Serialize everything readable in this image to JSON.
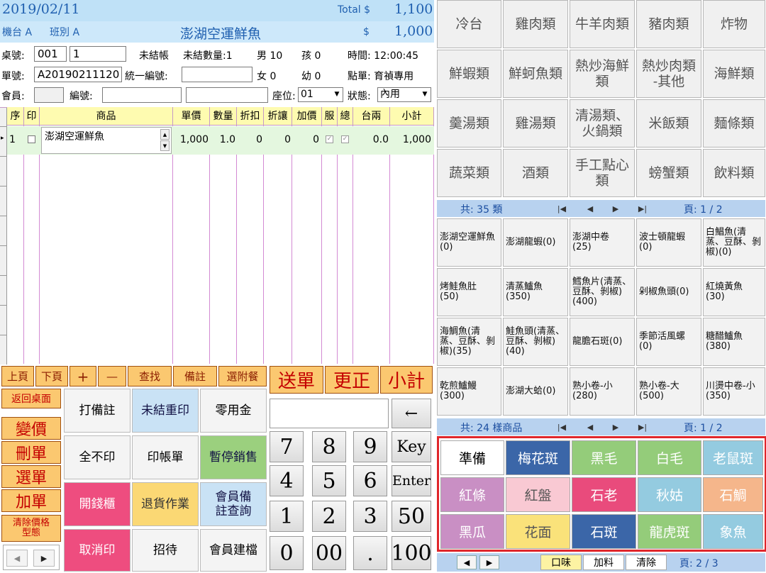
{
  "header": {
    "date": "2019/02/11",
    "total_label": "Total $",
    "total_value": "1,100",
    "register": "機台 A",
    "shift": "班別 A",
    "item_name": "澎湖空運鮮魚",
    "item_dollar": "$",
    "item_price": "1,000"
  },
  "info": {
    "table_label": "桌號:",
    "table_no": "001",
    "table_sub": "1",
    "unsettled": "未結帳",
    "unsettled_qty": "未結數量:1",
    "male": "男 10",
    "child": "孩 0",
    "time": "時間: 12:00:45",
    "order_label": "單號:",
    "order_no": "A20190211120",
    "tax_label": "統一編號:",
    "female": "女 0",
    "infant": "幼 0",
    "ordered_by": "點單: 育禎專用",
    "member_label": "會員:",
    "member_no_label": "編號:",
    "seat_label": "座位:",
    "seat_value": "01",
    "status_label": "狀態:",
    "status_value": "內用"
  },
  "table": {
    "headers": [
      "序",
      "印",
      "商品",
      "單價",
      "數量",
      "折扣",
      "折讓",
      "加價",
      "服",
      "總",
      "台兩",
      "小計"
    ],
    "rows": [
      {
        "seq": "1",
        "name": "澎湖空運鮮魚",
        "price": "1,000",
        "qty": "1.0",
        "disc": "0",
        "allow": "0",
        "extra": "0",
        "tael": "0.0",
        "subtotal": "1,000"
      }
    ]
  },
  "toolbar": {
    "small": [
      "上頁",
      "下頁",
      "+",
      "—",
      "查找",
      "備註",
      "選附餐"
    ],
    "big": [
      "送單",
      "更正",
      "小計"
    ]
  },
  "left_buttons": [
    "返回桌面",
    "變價",
    "刪單",
    "選單",
    "加單",
    "清除價格\n型態"
  ],
  "function_buttons": [
    [
      "打備註",
      "未結重印",
      "零用金"
    ],
    [
      "全不印",
      "印帳單",
      "暫停銷售"
    ],
    [
      "開錢櫃",
      "退貨作業",
      "會員備\n註查詢"
    ],
    [
      "取消印",
      "招待",
      "會員建檔"
    ]
  ],
  "keypad": {
    "backspace": "←",
    "rows": [
      [
        "7",
        "8",
        "9",
        "Key"
      ],
      [
        "4",
        "5",
        "6",
        "Enter"
      ],
      [
        "1",
        "2",
        "3",
        "50"
      ],
      [
        "0",
        "00",
        ".",
        "100"
      ]
    ]
  },
  "categories": [
    [
      "冷台",
      "雞肉類",
      "牛羊肉類",
      "豬肉類",
      "炸物"
    ],
    [
      "鮮蝦類",
      "鮮蚵魚類",
      "熱炒海鮮\n類",
      "熱炒肉類\n-其他",
      "海鮮類"
    ],
    [
      "羹湯類",
      "雞湯類",
      "清湯類、\n火鍋類",
      "米飯類",
      "麵條類"
    ],
    [
      "蔬菜類",
      "酒類",
      "手工點心\n類",
      "螃蟹類",
      "飲料類"
    ]
  ],
  "category_nav": {
    "total": "共: 35 類",
    "page": "頁: 1 / 2"
  },
  "products": [
    [
      "澎湖空運鮮魚(0)",
      "澎湖龍蝦(0)",
      "澎湖中卷\n(25)",
      "波士頓龍蝦\n(0)",
      "白鯧魚(清蒸、豆酥、剝椒)(0)"
    ],
    [
      "烤鮭魚肚\n(50)",
      "清蒸鱸魚\n(350)",
      "鱈魚片(清蒸、豆酥、剝椒)(400)",
      "剁椒魚頭(0)",
      "紅燒黃魚\n(30)"
    ],
    [
      "海鯛魚(清蒸、豆酥、剝椒)(35)",
      "鮭魚頭(清蒸、豆酥、剝椒)(40)",
      "龍膽石斑(0)",
      "季節活風螺\n(0)",
      "糖醋鱸魚\n(380)"
    ],
    [
      "乾煎鱸鰻\n(300)",
      "澎湖大蛤(0)",
      "熟小卷-小\n(280)",
      "熟小卷-大\n(500)",
      "川燙中卷-小(350)"
    ]
  ],
  "product_nav": {
    "total": "共: 24 樣商品",
    "page": "頁: 1 / 2"
  },
  "flavors": [
    {
      "label": "準備",
      "color": "#ffffff",
      "text": "#000000"
    },
    {
      "label": "梅花斑",
      "color": "#3b66a8",
      "text": "#ffffff"
    },
    {
      "label": "黑毛",
      "color": "#94cc7a",
      "text": "#ffffff"
    },
    {
      "label": "白毛",
      "color": "#94cc7a",
      "text": "#ffffff"
    },
    {
      "label": "老鼠斑",
      "color": "#94cbe0",
      "text": "#ffffff"
    },
    {
      "label": "紅條",
      "color": "#c98fc4",
      "text": "#ffffff"
    },
    {
      "label": "紅盤",
      "color": "#f9c9d3",
      "text": "#555555"
    },
    {
      "label": "石老",
      "color": "#e94b7c",
      "text": "#ffffff"
    },
    {
      "label": "秋姑",
      "color": "#94cbe0",
      "text": "#ffffff"
    },
    {
      "label": "石鯛",
      "color": "#f5b68b",
      "text": "#ffffff"
    },
    {
      "label": "黑瓜",
      "color": "#c98fc4",
      "text": "#ffffff"
    },
    {
      "label": "花面",
      "color": "#fae27a",
      "text": "#555555"
    },
    {
      "label": "石斑",
      "color": "#3b66a8",
      "text": "#ffffff"
    },
    {
      "label": "龍虎斑",
      "color": "#94cc7a",
      "text": "#ffffff"
    },
    {
      "label": "象魚",
      "color": "#94cbe0",
      "text": "#ffffff"
    }
  ],
  "bottom_bar": {
    "taste": "口味",
    "add": "加料",
    "clear": "清除",
    "page": "頁: 2 / 3"
  },
  "icons": {
    "nav_first": "|◀",
    "nav_prev": "◀",
    "nav_next": "▶",
    "nav_last": "▶|"
  }
}
